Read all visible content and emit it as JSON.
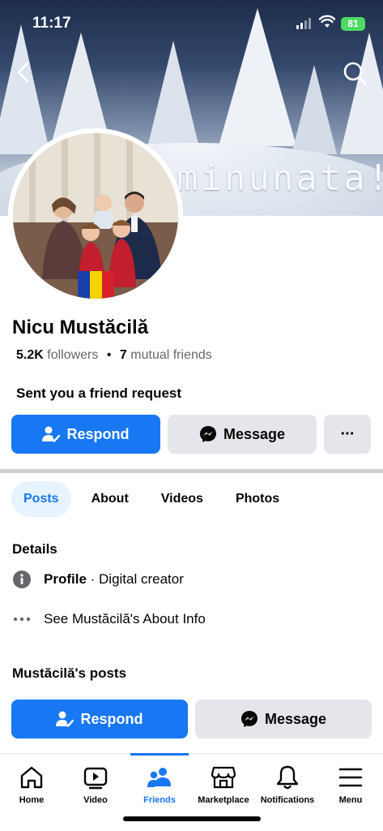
{
  "status_bar": {
    "time": "11:17",
    "battery": "81"
  },
  "cover": {
    "text": "minunata!"
  },
  "profile": {
    "name": "Nicu Mustăcilă",
    "followers_count": "5.2K",
    "followers_label": "followers",
    "separator": "•",
    "mutual_count": "7",
    "mutual_label": "mutual friends",
    "request_text": "Sent you a friend request"
  },
  "actions": {
    "respond": "Respond",
    "message": "Message",
    "more": "···"
  },
  "tabs": [
    {
      "label": "Posts",
      "active": true
    },
    {
      "label": "About",
      "active": false
    },
    {
      "label": "Videos",
      "active": false
    },
    {
      "label": "Photos",
      "active": false
    }
  ],
  "details": {
    "heading": "Details",
    "profile_label": "Profile",
    "profile_value": " · Digital creator",
    "about_link": "See Mustăcilă's About Info"
  },
  "posts": {
    "heading": "Mustăcilă's posts",
    "respond": "Respond",
    "message": "Message"
  },
  "bottom_nav": [
    {
      "label": "Home",
      "icon": "home-icon"
    },
    {
      "label": "Video",
      "icon": "video-icon"
    },
    {
      "label": "Friends",
      "icon": "friends-icon",
      "active": true
    },
    {
      "label": "Marketplace",
      "icon": "marketplace-icon"
    },
    {
      "label": "Notifications",
      "icon": "bell-icon"
    },
    {
      "label": "Menu",
      "icon": "menu-icon"
    }
  ],
  "colors": {
    "accent": "#1877f2",
    "button_grey": "#e4e6eb",
    "tab_active_bg": "#e7f3ff"
  }
}
